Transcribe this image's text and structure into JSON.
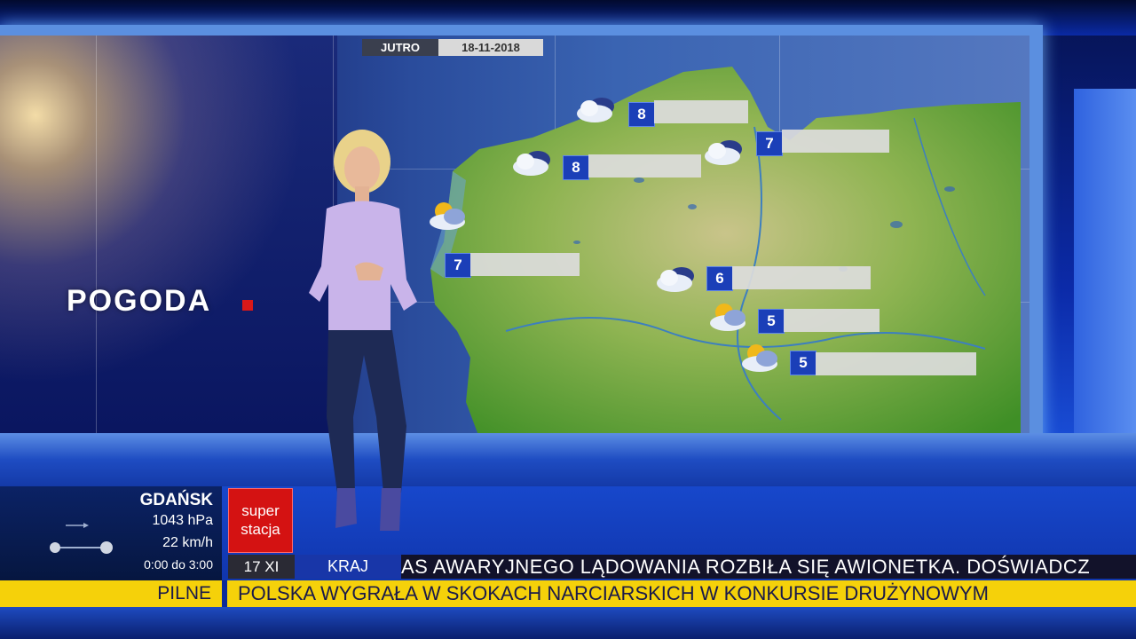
{
  "screen": {
    "title": "POGODA",
    "date_label": "JUTRO",
    "date_value": "18-11-2018"
  },
  "forecast": [
    {
      "temp": "8",
      "icon": "cloud-icon"
    },
    {
      "temp": "7",
      "icon": "cloud-icon"
    },
    {
      "temp": "8",
      "icon": "cloud-icon"
    },
    {
      "temp": "7",
      "icon": "sun-cloud-icon"
    },
    {
      "temp": "6",
      "icon": "cloud-icon"
    },
    {
      "temp": "5",
      "icon": "sun-cloud-icon"
    },
    {
      "temp": "5",
      "icon": "sun-cloud-icon"
    }
  ],
  "station": {
    "city": "GDAŃSK",
    "pressure": "1043 hPa",
    "wind": "22 km/h",
    "time_range": "0:00 do 3:00"
  },
  "channel": {
    "logo_line1": "super",
    "logo_line2": "stacja"
  },
  "ticker": {
    "date": "17 XI",
    "section": "KRAJ",
    "headline": "AS AWARYJNEGO LĄDOWANIA ROZBIŁA SIĘ AWIONETKA. DOŚWIADCZ",
    "breaking_label": "PILNE",
    "breaking_text": "POLSKA WYGRAŁA W SKOKACH NARCIARSKICH W KONKURSIE DRUŻYNOWYM"
  },
  "colors": {
    "accent_blue": "#1b3fb8",
    "breaking_yellow": "#f5d10a",
    "logo_red": "#d41212",
    "map_green": "#4f9a2c"
  }
}
